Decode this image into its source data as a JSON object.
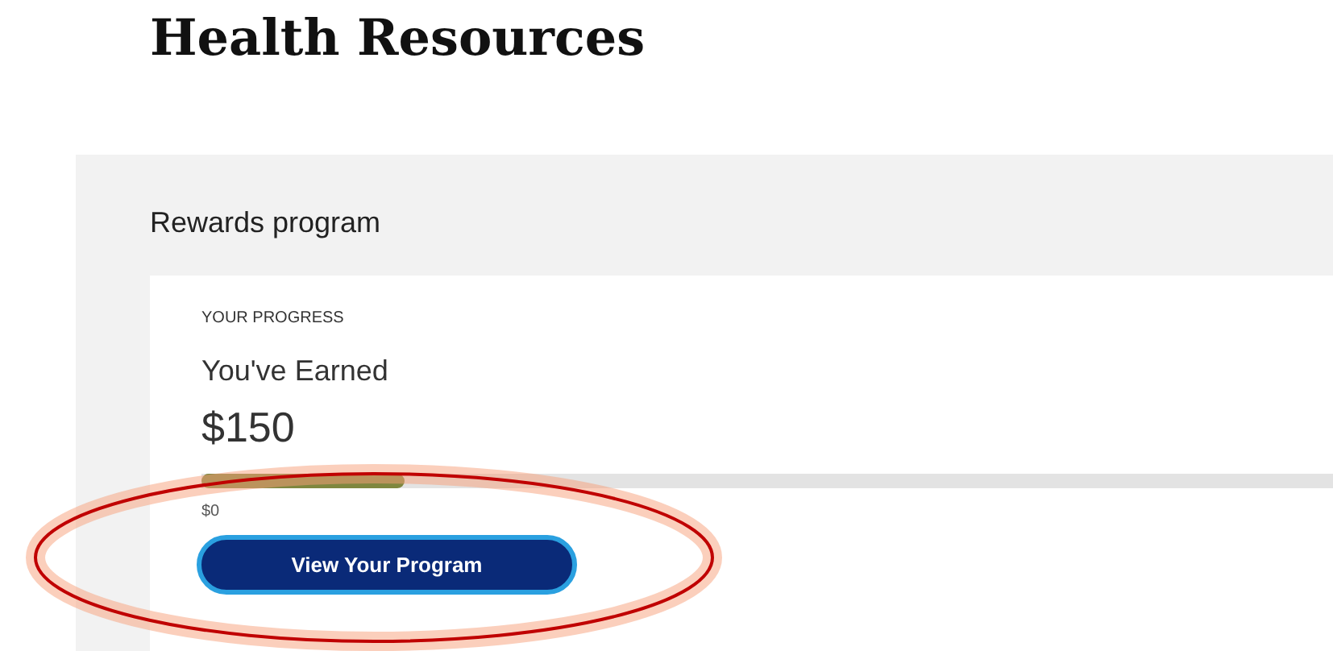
{
  "page": {
    "title": "Health Resources"
  },
  "rewards": {
    "heading": "Rewards program",
    "eyebrow": "YOUR PROGRESS",
    "label": "You've Earned",
    "amount": "$150",
    "level": 0.18,
    "min_label": "$0",
    "button": "View Your Program",
    "highlighted": true
  }
}
